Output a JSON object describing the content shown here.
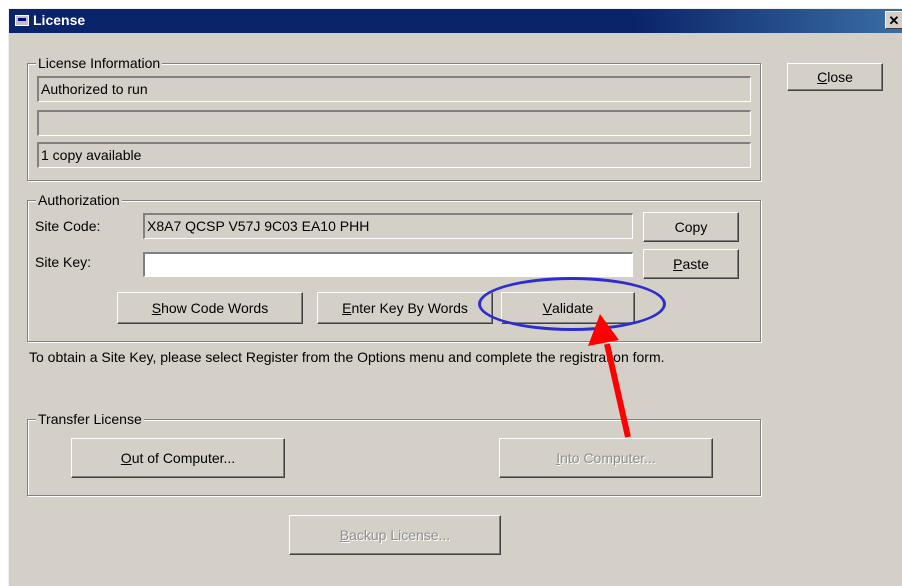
{
  "window": {
    "title": "License",
    "close_glyph": "✕"
  },
  "license_info": {
    "legend": "License Information",
    "line1": "Authorized to run",
    "line2": "",
    "line3": "1 copy available"
  },
  "close_button": {
    "accel": "C",
    "rest": "lose"
  },
  "authorization": {
    "legend": "Authorization",
    "site_code_label": "Site Code:",
    "site_code_value": "X8A7 QCSP V57J 9C03 EA10 PHH",
    "site_key_label": "Site Key:",
    "site_key_value": "",
    "copy_label": "Copy",
    "paste": {
      "accel": "P",
      "rest": "aste"
    },
    "show_code_words": {
      "accel": "S",
      "rest": "how Code Words"
    },
    "enter_key_by_words": {
      "accel": "E",
      "rest": "nter Key By Words"
    },
    "validate": {
      "accel": "V",
      "rest": "alidate"
    }
  },
  "info_text": "To obtain a Site Key, please select Register from the Options menu and complete the registration form.",
  "transfer": {
    "legend": "Transfer License",
    "out_of_computer": {
      "accel": "O",
      "rest": "ut of Computer..."
    },
    "into_computer": {
      "accel": "I",
      "rest": "nto Computer..."
    }
  },
  "backup": {
    "accel": "B",
    "rest": "ackup License..."
  },
  "annotation": {
    "highlight_color": "#2d2ccf",
    "arrow_color": "#ff0000"
  }
}
